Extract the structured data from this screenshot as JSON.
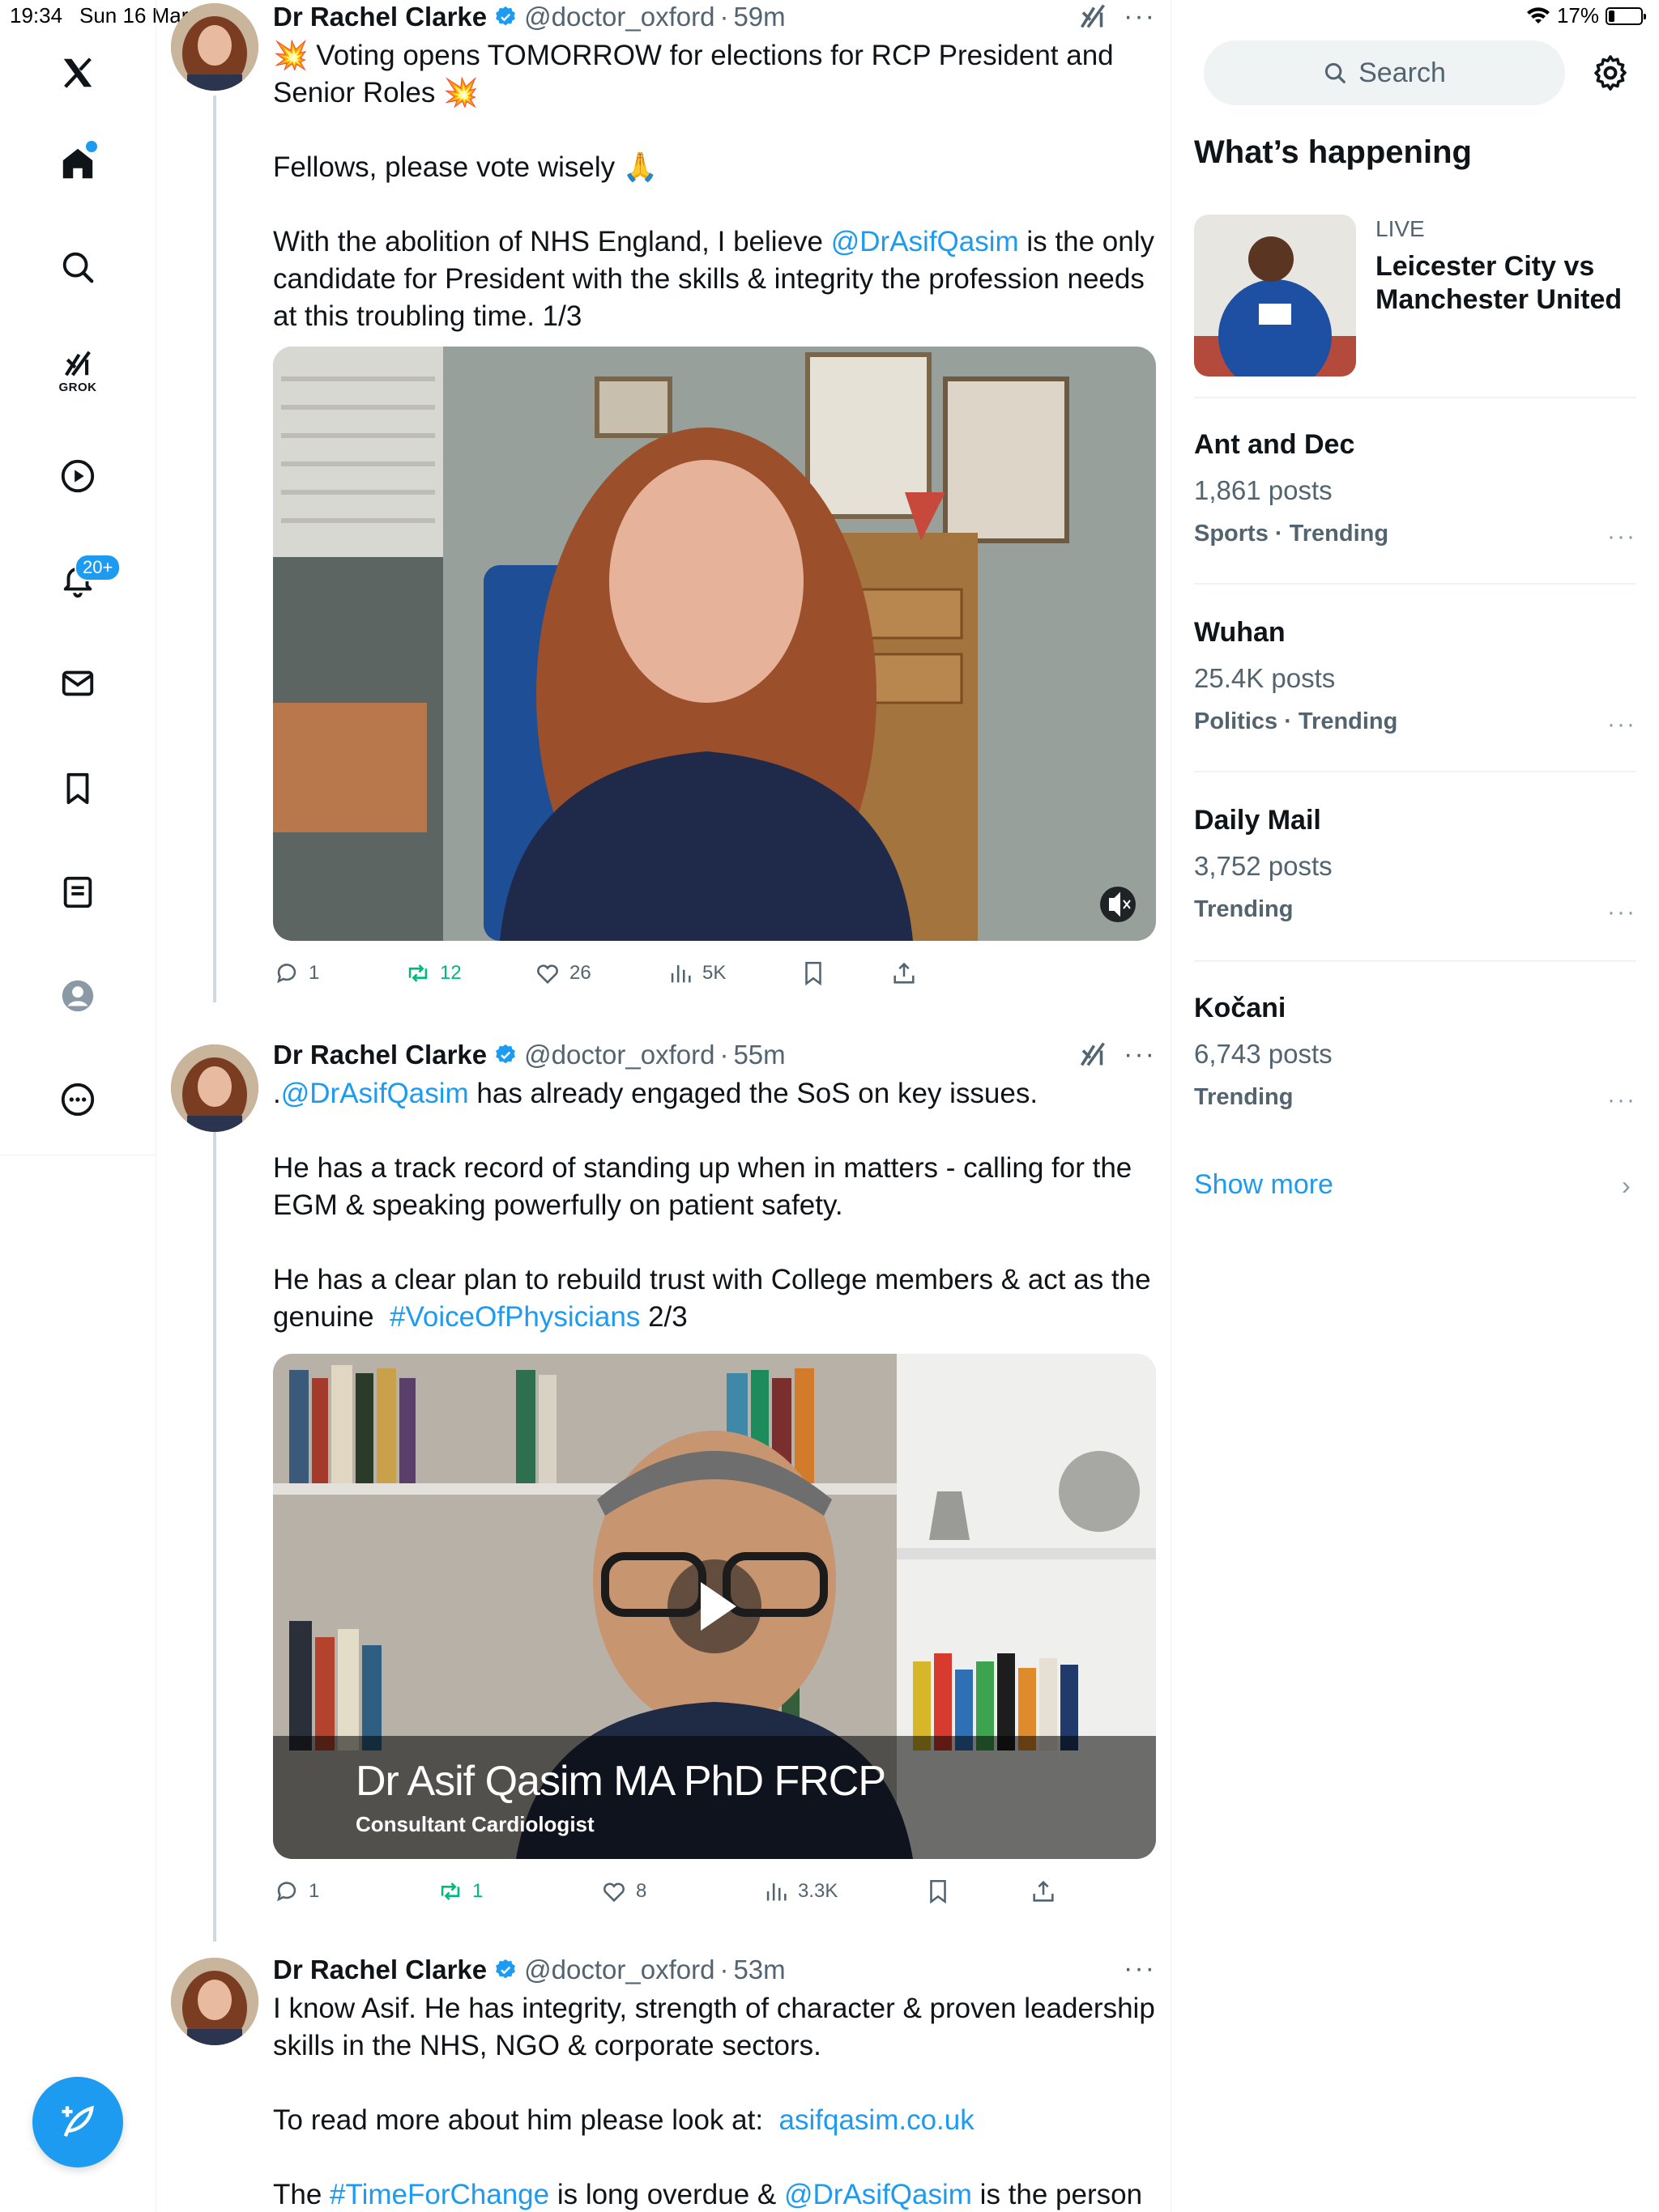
{
  "status_bar": {
    "time": "19:34",
    "date": "Sun 16 Mar",
    "battery": "17%"
  },
  "nav": {
    "grok_label": "GROK",
    "notifications_badge": "20+"
  },
  "search": {
    "placeholder": "Search"
  },
  "whats_happening": {
    "title": "What’s happening",
    "live": {
      "tag": "LIVE",
      "title": "Leicester City vs Manchester United"
    },
    "trends": [
      {
        "title": "Ant and Dec",
        "count": "1,861 posts",
        "category": "Sports · Trending"
      },
      {
        "title": "Wuhan",
        "count": "25.4K posts",
        "category": "Politics · Trending"
      },
      {
        "title": "Daily Mail",
        "count": "3,752 posts",
        "category": "Trending"
      },
      {
        "title": "Kočani",
        "count": "6,743 posts",
        "category": "Trending"
      }
    ],
    "show_more": "Show more"
  },
  "tweets": [
    {
      "name": "Dr Rachel Clarke",
      "handle": "@doctor_oxford",
      "time": "59m",
      "text": {
        "l1": "💥 Voting opens TOMORROW for elections for RCP President and Senior Roles 💥",
        "l2": "Fellows, please vote wisely 🙏",
        "l3a": "With the abolition of NHS England, I believe ",
        "l3link": "@DrAsifQasim",
        "l3b": " is the only candidate for President with the skills & integrity the profession needs at this troubling time. 1/3"
      },
      "stats": {
        "replies": "1",
        "reposts": "12",
        "likes": "26",
        "views": "5K"
      }
    },
    {
      "name": "Dr Rachel Clarke",
      "handle": "@doctor_oxford",
      "time": "55m",
      "text": {
        "l1a": ".",
        "l1link": "@DrAsifQasim",
        "l1b": " has already engaged the SoS on key issues.",
        "l2": "He has a track record of standing up when in matters - calling for the EGM & speaking powerfully on patient safety.",
        "l3a": "He has a clear plan to rebuild trust with College members & act as the genuine  ",
        "l3link": "#VoiceOfPhysicians",
        "l3b": " 2/3"
      },
      "video_caption": {
        "title": "Dr Asif Qasim MA PhD FRCP",
        "subtitle": "Consultant Cardiologist"
      },
      "stats": {
        "replies": "1",
        "reposts": "1",
        "likes": "8",
        "views": "3.3K"
      }
    },
    {
      "name": "Dr Rachel Clarke",
      "handle": "@doctor_oxford",
      "time": "53m",
      "text": {
        "l1": "I know Asif. He has integrity, strength of character & proven leadership skills in the NHS, NGO & corporate sectors.",
        "l2a": "To read more about him please look at:  ",
        "l2link": "asifqasim.co.uk",
        "l3a": "The ",
        "l3link1": "#TimeForChange",
        "l3b": " is long overdue & ",
        "l3link2": "@DrAsifQasim",
        "l3c": " is the person to"
      }
    }
  ],
  "colors": {
    "accent": "#1d9bf0",
    "repost_green": "#00ba7c",
    "muted": "#536471"
  }
}
